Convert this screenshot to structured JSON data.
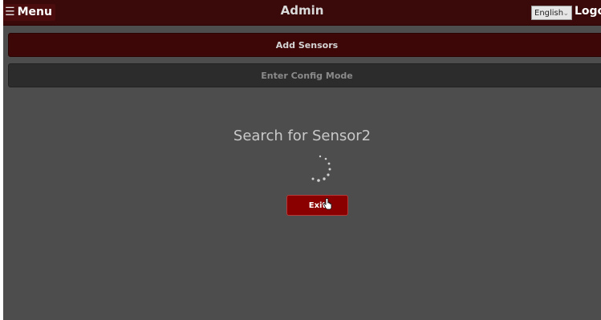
{
  "header": {
    "menu_icon": "hamburger-icon",
    "menu_label": "Menu",
    "title": "Admin",
    "language_selected": "English",
    "logout_label": "Logo"
  },
  "actions": {
    "add_sensors_label": "Add Sensors",
    "config_mode_label": "Enter Config Mode"
  },
  "dialog": {
    "title": "Search for Sensor2",
    "spinner_icon": "loading-spinner-icon",
    "exit_label": "Exit"
  },
  "colors": {
    "background": "#4d4d4d",
    "topbar": "#3a0a0a",
    "accent": "#8a0000"
  }
}
